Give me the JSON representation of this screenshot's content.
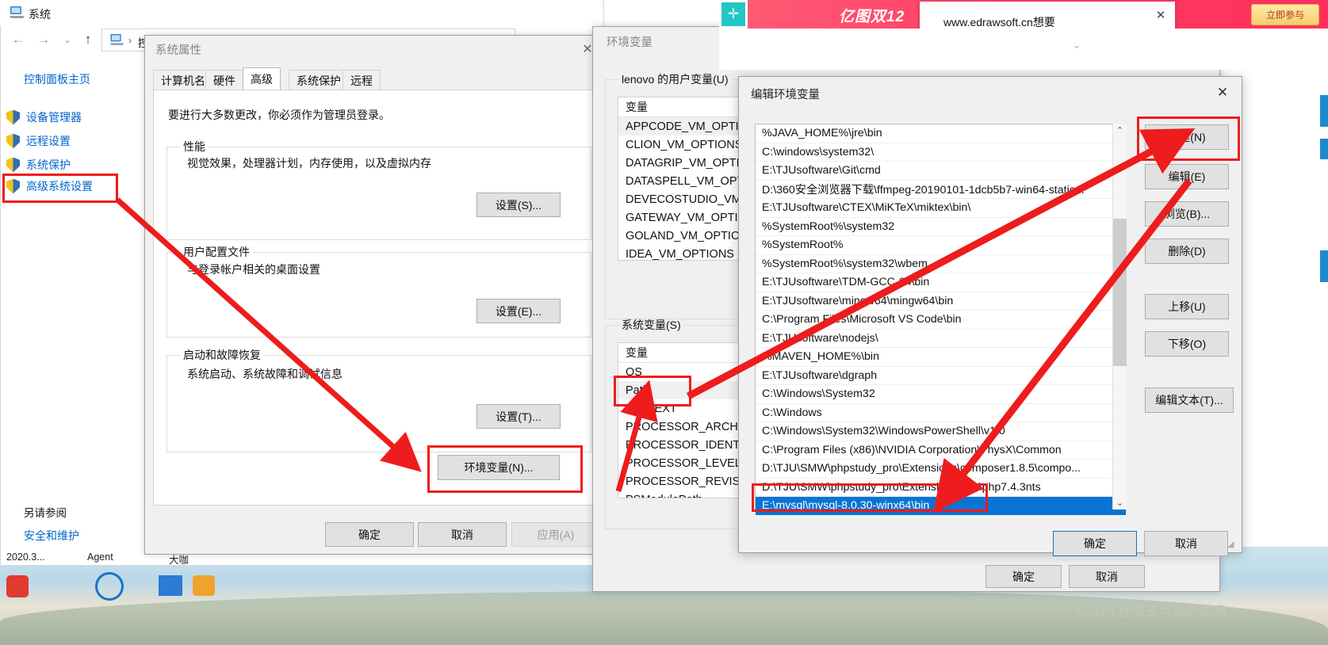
{
  "control_panel": {
    "window_title": "系统",
    "icon": "computer-icon",
    "nav": {
      "back": "←",
      "forward": "→",
      "recent": "⌄",
      "up": "↑"
    },
    "address": {
      "icon": "computer-icon",
      "separator": "›",
      "text": "控"
    },
    "close": "✕",
    "home_link": "控制面板主页",
    "items": [
      {
        "label": "设备管理器",
        "icon": "shield-icon"
      },
      {
        "label": "远程设置",
        "icon": "shield-icon"
      },
      {
        "label": "系统保护",
        "icon": "shield-icon"
      },
      {
        "label": "高级系统设置",
        "icon": "shield-icon",
        "highlighted": true
      }
    ],
    "see_also_label": "另请参阅",
    "see_also_items": [
      {
        "label": "安全和维护"
      }
    ]
  },
  "system_properties": {
    "title": "系统属性",
    "close": "✕",
    "tabs": [
      {
        "label": "计算机名",
        "selected": false
      },
      {
        "label": "硬件",
        "selected": false
      },
      {
        "label": "高级",
        "selected": true
      },
      {
        "label": "系统保护",
        "selected": false
      },
      {
        "label": "远程",
        "selected": false
      }
    ],
    "note": "要进行大多数更改，你必须作为管理员登录。",
    "groups": [
      {
        "legend": "性能",
        "desc": "视觉效果，处理器计划，内存使用，以及虚拟内存",
        "button": "设置(S)..."
      },
      {
        "legend": "用户配置文件",
        "desc": "与登录帐户相关的桌面设置",
        "button": "设置(E)..."
      },
      {
        "legend": "启动和故障恢复",
        "desc": "系统启动、系统故障和调试信息",
        "button": "设置(T)..."
      }
    ],
    "env_button": "环境变量(N)...",
    "ok": "确定",
    "cancel": "取消",
    "apply": "应用(A)"
  },
  "environment_variables": {
    "title": "环境变量",
    "close": "✕",
    "user_group_label": "lenovo 的用户变量(U)",
    "user_column_header": "变量",
    "user_rows": [
      "APPCODE_VM_OPTIONS",
      "CLION_VM_OPTIONS",
      "DATAGRIP_VM_OPTIONS",
      "DATASPELL_VM_OPTIONS",
      "DEVECOSTUDIO_VM_OPTIONS",
      "GATEWAY_VM_OPTIONS",
      "GOLAND_VM_OPTIONS",
      "IDEA_VM_OPTIONS"
    ],
    "sys_group_label": "系统变量(S)",
    "sys_column_header": "变量",
    "sys_rows": [
      "OS",
      "Path",
      "PATHEXT",
      "PROCESSOR_ARCHITECTURE",
      "PROCESSOR_IDENTIFIER",
      "PROCESSOR_LEVEL",
      "PROCESSOR_REVISION",
      "PSModulePath"
    ],
    "selected_sys_row": "Path",
    "ok": "确定",
    "cancel": "取消"
  },
  "edit_environment_variable": {
    "title": "编辑环境变量",
    "close": "✕",
    "entries": [
      "%JAVA_HOME%\\jre\\bin",
      "C:\\windows\\system32\\",
      "E:\\TJUsoftware\\Git\\cmd",
      "D:\\360安全浏览器下载\\ffmpeg-20190101-1dcb5b7-win64-static...",
      "E:\\TJUsoftware\\CTEX\\MiKTeX\\miktex\\bin\\",
      "%SystemRoot%\\system32",
      "%SystemRoot%",
      "%SystemRoot%\\system32\\wbem",
      "E:\\TJUsoftware\\TDM-GCC-64\\bin",
      "E:\\TJUsoftware\\mingw64\\mingw64\\bin",
      "C:\\Program Files\\Microsoft VS Code\\bin",
      "E:\\TJUsoftware\\nodejs\\",
      "%MAVEN_HOME%\\bin",
      "E:\\TJUsoftware\\dgraph",
      "C:\\Windows\\System32",
      "C:\\Windows",
      "C:\\Windows\\System32\\WindowsPowerShell\\v1.0",
      "C:\\Program Files (x86)\\NVIDIA Corporation\\PhysX\\Common",
      "D:\\TJU\\SMW\\phpstudy_pro\\Extensions\\composer1.8.5\\compo...",
      "D:\\TJU\\SMW\\phpstudy_pro\\Extensions\\php\\php7.4.3nts"
    ],
    "selected_entry": "E:\\mysql\\mysql-8.0.30-winx64\\bin",
    "scroll_up": "⌃",
    "scroll_down": "⌄",
    "buttons": [
      {
        "label": "新建(N)",
        "highlighted": true
      },
      {
        "label": "编辑(E)"
      },
      {
        "label": "浏览(B)..."
      },
      {
        "label": "删除(D)"
      },
      {
        "label": "上移(U)"
      },
      {
        "label": "下移(O)"
      },
      {
        "label": "编辑文本(T)..."
      }
    ],
    "ok": "确定",
    "cancel": "取消"
  },
  "browser_ad": {
    "logo": "edraw-logo-icon",
    "banner_text": "亿图双12",
    "banner_text2": "，",
    "cta": "立即参与",
    "popup_text": "www.edrawsoft.cn想要",
    "popup_close": "✕"
  },
  "taskbar": {
    "date_label": "2020.3...",
    "agent_label": "Agent",
    "other_label": "大咖"
  },
  "watermark": "CSDN @失去斗志的菜鸟",
  "colors": {
    "annotation_red": "#ee1c1c",
    "selection_blue": "#0a74d4",
    "link_blue": "#0066cc",
    "ad_pink": "#ff3d66"
  }
}
